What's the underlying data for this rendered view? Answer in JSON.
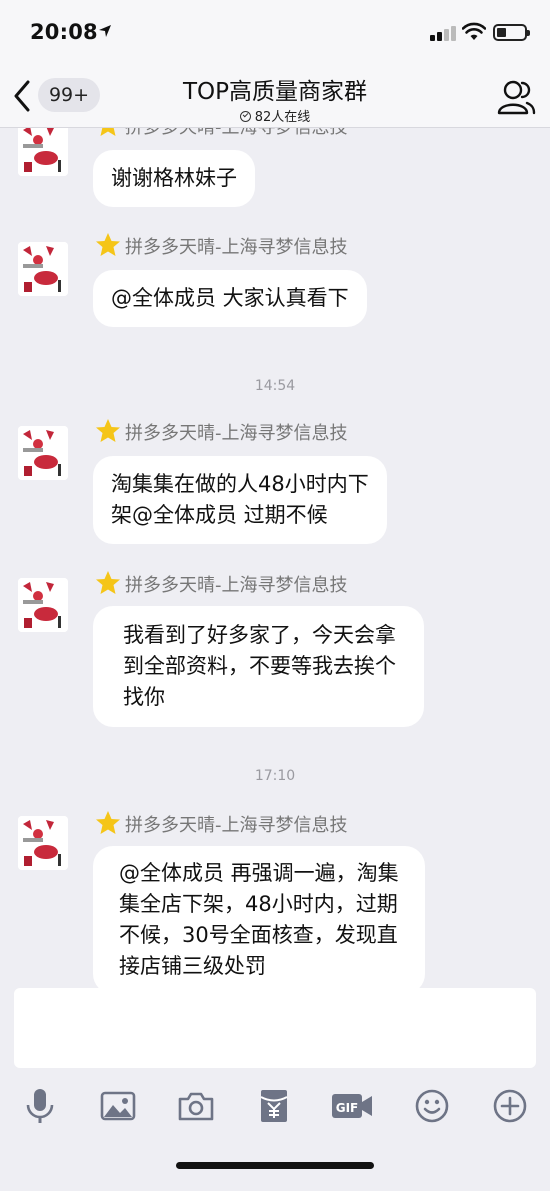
{
  "status_bar": {
    "time": "20:08"
  },
  "header": {
    "title": "TOP高质量商家群",
    "online_count": "82人在线",
    "unread_badge": "99+"
  },
  "messages": [
    {
      "type": "message",
      "sender": "拼多多天晴-上海寻梦信息技",
      "text": "谢谢格林妹子"
    },
    {
      "type": "message",
      "sender": "拼多多天晴-上海寻梦信息技",
      "text": "@全体成员 大家认真看下"
    },
    {
      "type": "time",
      "text": "14:54"
    },
    {
      "type": "message",
      "sender": "拼多多天晴-上海寻梦信息技",
      "lines": [
        "淘集集在做的人48小时内下",
        "架@全体成员 过期不候"
      ]
    },
    {
      "type": "message",
      "sender": "拼多多天晴-上海寻梦信息技",
      "lines": [
        "我看到了好多家了，今天会拿",
        "到全部资料，不要等我去挨个",
        "找你"
      ]
    },
    {
      "type": "time",
      "text": "17:10"
    },
    {
      "type": "message",
      "sender": "拼多多天晴-上海寻梦信息技",
      "lines": [
        "@全体成员 再强调一遍，淘集",
        "集全店下架，48小时内，过期",
        "不候，30号全面核查，发现直",
        "接店铺三级处罚"
      ]
    }
  ],
  "input": {
    "value": ""
  },
  "toolbar": [
    "microphone-icon",
    "image-icon",
    "camera-icon",
    "red-packet-icon",
    "gif-icon",
    "emoji-icon",
    "plus-icon"
  ],
  "colors": {
    "background": "#eeeef3",
    "bubble": "#ffffff",
    "star": "#f5c518",
    "sender": "#777777",
    "timestamp": "#9a9aa0"
  }
}
